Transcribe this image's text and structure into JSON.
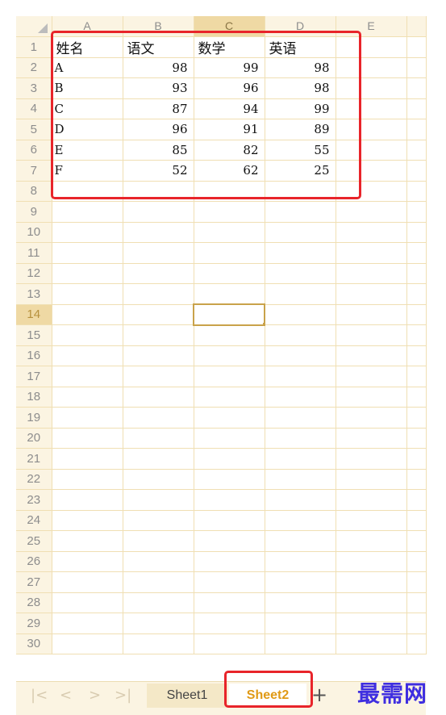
{
  "columns": [
    "A",
    "B",
    "C",
    "D",
    "E"
  ],
  "selected_column": "C",
  "selected_row": "14",
  "rows": [
    {
      "num": "1",
      "a": "姓名",
      "b": "语文",
      "c": "数学",
      "d": "英语"
    },
    {
      "num": "2",
      "a": "A",
      "b": "98",
      "c": "99",
      "d": "98"
    },
    {
      "num": "3",
      "a": "B",
      "b": "93",
      "c": "96",
      "d": "98"
    },
    {
      "num": "4",
      "a": "C",
      "b": "87",
      "c": "94",
      "d": "99"
    },
    {
      "num": "5",
      "a": "D",
      "b": "96",
      "c": "91",
      "d": "89"
    },
    {
      "num": "6",
      "a": "E",
      "b": "85",
      "c": "82",
      "d": "55"
    },
    {
      "num": "7",
      "a": "F",
      "b": "52",
      "c": "62",
      "d": "25"
    }
  ],
  "empty_rows": [
    "8",
    "9",
    "10",
    "11",
    "12",
    "13",
    "14",
    "15",
    "16",
    "17",
    "18",
    "19",
    "20",
    "21",
    "22",
    "23",
    "24",
    "25",
    "26",
    "27",
    "28",
    "29",
    "30"
  ],
  "sheet_tabs": {
    "sheet1": "Sheet1",
    "sheet2": "Sheet2",
    "active": "Sheet2"
  },
  "nav": {
    "first": "|<",
    "prev": "<",
    "next": ">",
    "last": ">|",
    "add": "+"
  },
  "watermark": "最需网",
  "colors": {
    "header_bg": "#fbf4e2",
    "gridline": "#f0dfb3",
    "selection": "#c9a24a",
    "highlight_box": "#e8242a",
    "active_tab_text": "#e09a16",
    "watermark": "#3f2ee0"
  }
}
